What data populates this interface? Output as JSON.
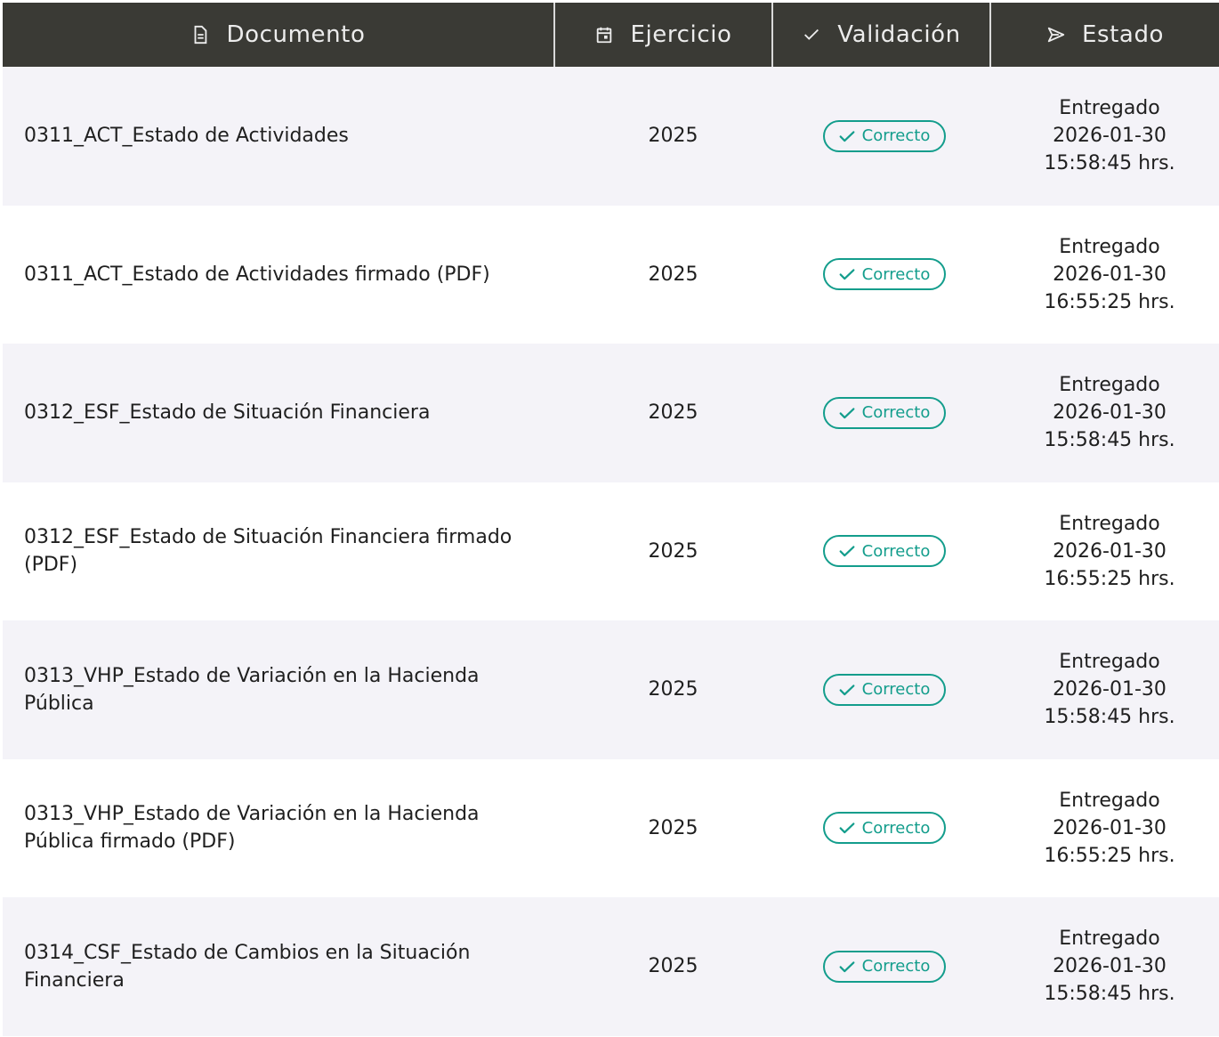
{
  "header": {
    "documento": "Documento",
    "ejercicio": "Ejercicio",
    "validacion": "Validación",
    "estado": "Estado"
  },
  "icons": {
    "documento": "document-icon",
    "ejercicio": "calendar-icon",
    "validacion": "check-icon",
    "estado": "send-icon",
    "badge": "check-icon"
  },
  "colors": {
    "header_bg": "#3a3a35",
    "accent": "#139d8c",
    "row_alt": "#f4f3f8"
  },
  "rows": [
    {
      "documento": "0311_ACT_Estado de Actividades",
      "ejercicio": "2025",
      "validacion": "Correcto",
      "estado": "Entregado",
      "fecha": "2026-01-30",
      "hora": "15:58:45 hrs."
    },
    {
      "documento": "0311_ACT_Estado de Actividades firmado (PDF)",
      "ejercicio": "2025",
      "validacion": "Correcto",
      "estado": "Entregado",
      "fecha": "2026-01-30",
      "hora": "16:55:25 hrs."
    },
    {
      "documento": "0312_ESF_Estado de Situación Financiera",
      "ejercicio": "2025",
      "validacion": "Correcto",
      "estado": "Entregado",
      "fecha": "2026-01-30",
      "hora": "15:58:45 hrs."
    },
    {
      "documento": "0312_ESF_Estado de Situación Financiera firmado (PDF)",
      "ejercicio": "2025",
      "validacion": "Correcto",
      "estado": "Entregado",
      "fecha": "2026-01-30",
      "hora": "16:55:25 hrs."
    },
    {
      "documento": "0313_VHP_Estado de Variación en la Hacienda Pública",
      "ejercicio": "2025",
      "validacion": "Correcto",
      "estado": "Entregado",
      "fecha": "2026-01-30",
      "hora": "15:58:45 hrs."
    },
    {
      "documento": "0313_VHP_Estado de Variación en la Hacienda Pública firmado (PDF)",
      "ejercicio": "2025",
      "validacion": "Correcto",
      "estado": "Entregado",
      "fecha": "2026-01-30",
      "hora": "16:55:25 hrs."
    },
    {
      "documento": "0314_CSF_Estado de Cambios en la Situación Financiera",
      "ejercicio": "2025",
      "validacion": "Correcto",
      "estado": "Entregado",
      "fecha": "2026-01-30",
      "hora": "15:58:45 hrs."
    }
  ]
}
